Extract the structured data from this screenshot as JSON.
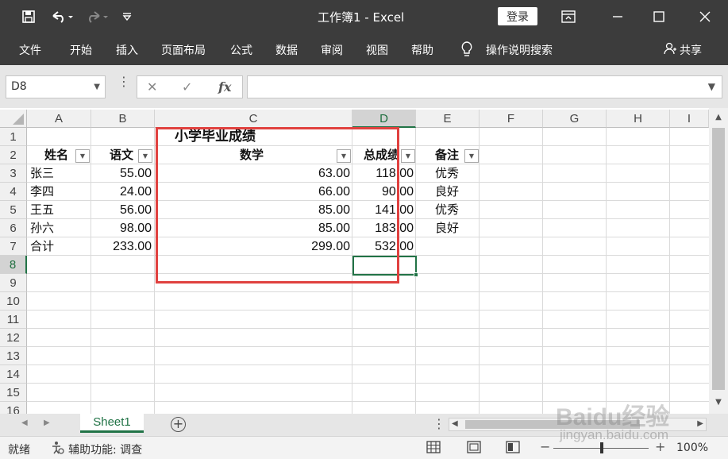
{
  "titlebar": {
    "title": "工作簿1  -  Excel",
    "login_label": "登录",
    "quick_access": [
      "save-icon",
      "undo-icon",
      "redo-icon",
      "customize-icon"
    ]
  },
  "ribbon": {
    "tabs": [
      "文件",
      "开始",
      "插入",
      "页面布局",
      "公式",
      "数据",
      "审阅",
      "视图",
      "帮助"
    ],
    "tell_me": "操作说明搜索",
    "share": "共享"
  },
  "formula_bar": {
    "name_box": "D8",
    "fx_label": "fx",
    "formula": ""
  },
  "grid": {
    "columns": [
      "A",
      "B",
      "C",
      "D",
      "E",
      "F",
      "G",
      "H",
      "I"
    ],
    "rows": [
      "1",
      "2",
      "3",
      "4",
      "5",
      "6",
      "7",
      "8",
      "9",
      "10",
      "11",
      "12",
      "13",
      "14",
      "15",
      "16"
    ],
    "title": "小学毕业成绩",
    "headers": [
      "姓名",
      "语文",
      "数学",
      "总成绩",
      "备注"
    ],
    "data": [
      [
        "张三",
        "55.00",
        "63.00",
        "118.00",
        "优秀"
      ],
      [
        "李四",
        "24.00",
        "66.00",
        "90.00",
        "良好"
      ],
      [
        "王五",
        "56.00",
        "85.00",
        "141.00",
        "优秀"
      ],
      [
        "孙六",
        "98.00",
        "85.00",
        "183.00",
        "良好"
      ],
      [
        "合计",
        "233.00",
        "299.00",
        "532.00",
        ""
      ]
    ],
    "selected_cell": "D8"
  },
  "sheets": {
    "tabs": [
      "Sheet1"
    ]
  },
  "statusbar": {
    "ready": "就绪",
    "accessibility": "辅助功能: 调查",
    "zoom": "100%"
  },
  "watermark": {
    "brand": "Baidu经验",
    "url": "jingyan.baidu.com"
  },
  "colors": {
    "excel_green": "#217346",
    "titlebar_bg": "#3c3c3c",
    "highlight_red": "#e0413f"
  }
}
